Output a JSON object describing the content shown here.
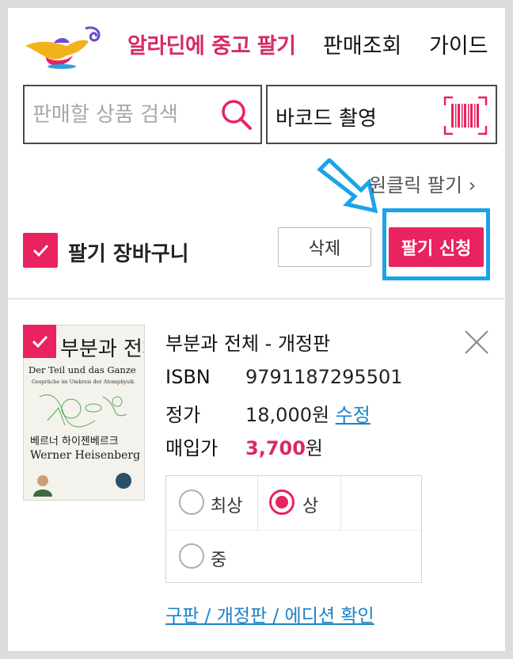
{
  "header": {
    "nav": {
      "sell": "알라딘에 중고 팔기",
      "lookup": "판매조회",
      "guide": "가이드"
    }
  },
  "search": {
    "placeholder": "판매할 상품 검색",
    "barcode_label": "바코드 촬영"
  },
  "oneclick": {
    "label": "원클릭 팔기",
    "chevron": "›"
  },
  "cart": {
    "title": "팔기 장바구니",
    "delete_label": "삭제",
    "submit_label": "팔기 신청"
  },
  "item": {
    "title": "부분과 전체 - 개정판",
    "isbn_label": "ISBN",
    "isbn": "9791187295501",
    "list_price_label": "정가",
    "list_price": "18,000원",
    "edit_label": "수정",
    "buy_price_label": "매입가",
    "buy_price": "3,700",
    "buy_price_unit": "원",
    "cover": {
      "title": "부분과 전체",
      "subtitle_de": "Der Teil und das Ganze",
      "tagline_de": "Gespräche im Umkreis der Atomphysik",
      "author_ko": "베르너 하이젠베르크",
      "author_en": "Werner Heisenberg"
    },
    "grades": [
      {
        "label": "최상",
        "selected": false
      },
      {
        "label": "상",
        "selected": true
      },
      {
        "label": "중",
        "selected": false
      }
    ],
    "edition_link": "구판 / 개정판 / 에디션 확인"
  },
  "colors": {
    "accent": "#e8235f",
    "brand_text": "#d72b62",
    "link": "#1a82c9",
    "highlight": "#1aa3e8"
  },
  "icons": [
    "lamp-logo-icon",
    "search-icon",
    "barcode-icon",
    "check-icon",
    "close-icon",
    "arrow-icon"
  ]
}
